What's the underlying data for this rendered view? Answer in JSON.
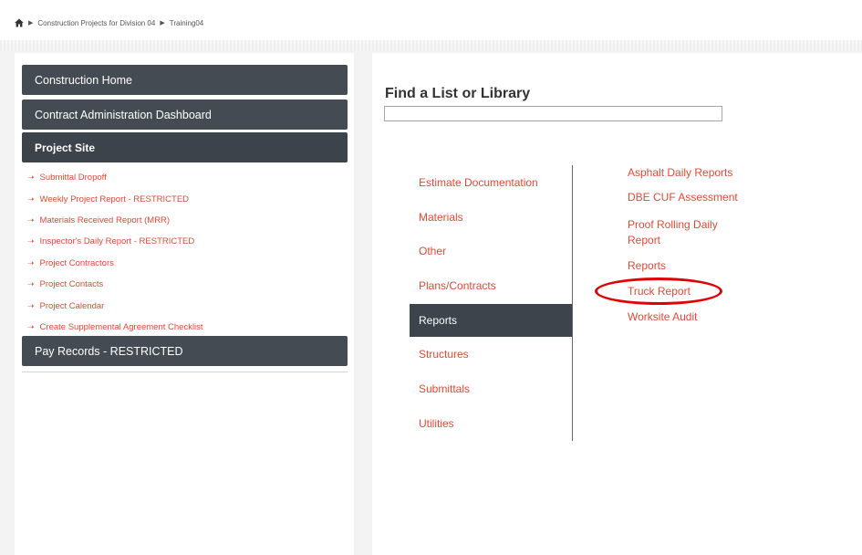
{
  "breadcrumb": {
    "items": [
      "Construction Projects for Division 04",
      "Training04"
    ],
    "home_icon": "home-icon",
    "separator_icon": "triangle-right-icon"
  },
  "sidebar": {
    "headers": [
      "Construction Home",
      "Contract Administration Dashboard",
      "Project Site"
    ],
    "sub_items": [
      "Submittal Dropoff",
      "Weekly Project Report - RESTRICTED",
      "Materials Received Report (MRR)",
      "Inspector's Daily Report - RESTRICTED",
      "Project Contractors",
      "Project Contacts",
      "Project Calendar",
      "Create Supplemental Agreement Checklist"
    ],
    "bottom_header": "Pay Records - RESTRICTED"
  },
  "finder": {
    "title": "Find a List or Library",
    "search_value": "",
    "categories": [
      "Estimate Documentation",
      "Materials",
      "Other",
      "Plans/Contracts",
      "Reports",
      "Structures",
      "Submittals",
      "Utilities"
    ],
    "selected_category": "Reports",
    "libraries": [
      "Asphalt Daily Reports",
      "DBE CUF Assessment",
      "Proof Rolling Daily Report",
      "Reports",
      "Truck Report",
      "Worksite Audit"
    ],
    "highlighted_library": "Truck Report"
  },
  "colors": {
    "accent_link": "#e24a36",
    "nav_dark": "#444b52",
    "highlight_circle": "#e00000"
  }
}
